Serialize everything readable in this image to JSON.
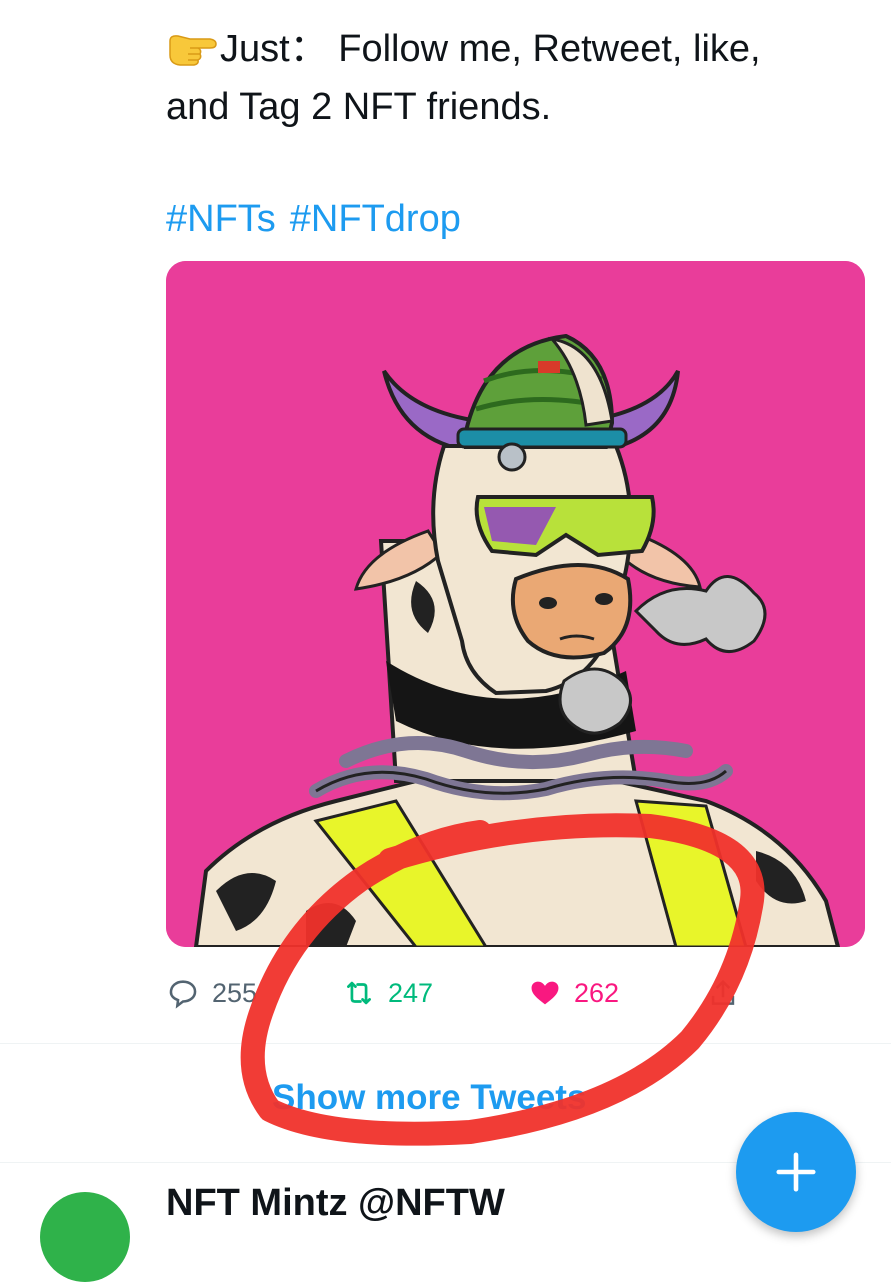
{
  "tweet": {
    "line1": "Just：  Follow me, Retweet, like,",
    "line2": "and Tag 2 NFT  friends.",
    "hashtags": [
      "#NFTs",
      "#NFTdrop"
    ],
    "emoji": "pointing-right-icon"
  },
  "actions": {
    "replies": "255",
    "retweets": "247",
    "likes": "262"
  },
  "show_more_label": "Show more Tweets",
  "next_tweet_header": "NFT Mintz   @NFTW",
  "colors": {
    "accent": "#1d9bf0",
    "retweet": "#00ba7c",
    "like": "#f91880",
    "media_background": "#e93d9a",
    "annotation": "#f0312b"
  }
}
